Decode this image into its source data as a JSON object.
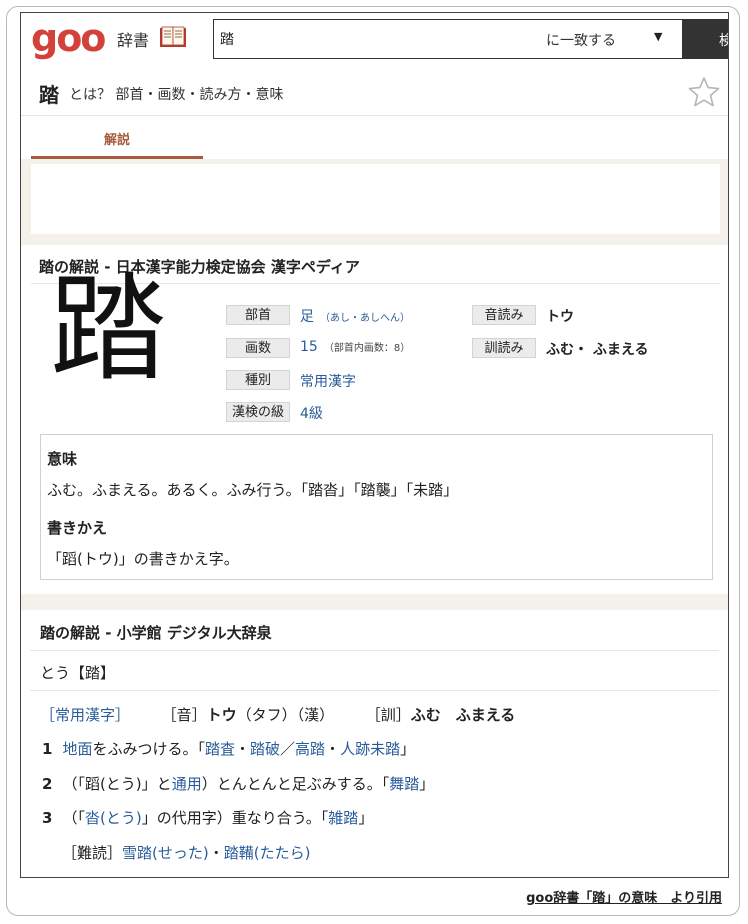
{
  "header": {
    "logo": "goo",
    "dict_label": "辞書",
    "search_value": "踏",
    "match_mode": "に一致する",
    "search_button": "検"
  },
  "title": {
    "kanji": "踏",
    "subtitle": "とは？ 部首・画数・読み方・意味"
  },
  "tabs": [
    {
      "label": "解説"
    }
  ],
  "kanjipedia": {
    "section_title": "踏の解説 - 日本漢字能力検定協会 漢字ペディア",
    "kanji": "踏",
    "bushu_label": "部首",
    "bushu_value": "足",
    "bushu_note": "（あし・あしへん）",
    "kakusu_label": "画数",
    "kakusu_value": "15",
    "kakusu_note": "（部首内画数：8）",
    "shubetsu_label": "種別",
    "shubetsu_value": "常用漢字",
    "kyu_label": "漢検の級",
    "kyu_value": "4級",
    "on_label": "音読み",
    "on_value": "トウ",
    "kun_label": "訓読み",
    "kun_value": "ふむ・ ふまえる",
    "meaning_heading": "意味",
    "meaning_text": "ふむ。ふまえる。あるく。ふみ行う。「踏沓」「踏襲」「未踏」",
    "kakikae_heading": "書きかえ",
    "kakikae_text": "「蹈(トウ)」の書きかえ字。"
  },
  "daijisen": {
    "section_title": "踏の解説 - 小学館 デジタル大辞泉",
    "headword": "とう【踏】",
    "joyo": "［常用漢字］",
    "on_tag": "［音］",
    "on_value": "トウ",
    "on_extra": "（タフ）（漢）",
    "kun_tag": "［訓］",
    "kun_value": "ふむ　ふまえる",
    "def1_num": "1",
    "def1_link1": "地面",
    "def1_text1": "をふみつける。「",
    "def1_link2": "踏査",
    "def1_sep1": "・",
    "def1_link3": "踏破",
    "def1_sep2": "／",
    "def1_link4": "高踏",
    "def1_sep3": "・",
    "def1_link5": "人跡未踏",
    "def1_end": "」",
    "def2_num": "2",
    "def2_text1": "（「蹈",
    "def2_ruby": "(とう)",
    "def2_text2": "」と",
    "def2_link1": "通用",
    "def2_text3": "）とんとんと足ぶみする。「",
    "def2_link2": "舞踏",
    "def2_end": "」",
    "def3_num": "3",
    "def3_text1": "（「",
    "def3_link1": "沓",
    "def3_ruby": "(とう)",
    "def3_text2": "」の代用字）重なり合う。「",
    "def3_link2": "雑踏",
    "def3_end": "」",
    "nandoku_tag": "［難読］",
    "nandoku_link1": "雪踏",
    "nandoku_ruby1": "(せった)",
    "nandoku_sep": "・",
    "nandoku_link2": "踏鞴",
    "nandoku_ruby2": "(たたら)"
  },
  "footer": {
    "citation": "goo辞書「踏」の意味　より引用"
  },
  "colors": {
    "logo_red": "#d3413b",
    "tab_accent": "#a85a3e",
    "link_blue": "#2a5c9a",
    "band": "#f4f1ea"
  }
}
